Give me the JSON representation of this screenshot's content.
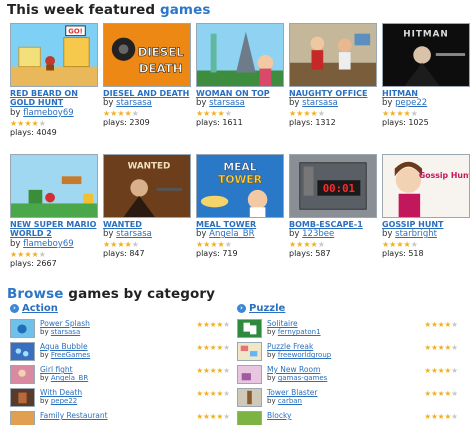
{
  "featured": {
    "title_prefix": "This week featured ",
    "title_accent": "games",
    "by_label": "by ",
    "plays_label": "plays: ",
    "games": [
      {
        "name": "RED BEARD ON GOLD HUNT",
        "author": "flameboy69",
        "plays": "4049",
        "rating": 4
      },
      {
        "name": "DIESEL AND DEATH",
        "author": "starsasa",
        "plays": "2309",
        "rating": 4
      },
      {
        "name": "WOMAN ON TOP",
        "author": "starsasa",
        "plays": "1611",
        "rating": 4
      },
      {
        "name": "NAUGHTY OFFICE",
        "author": "starsasa",
        "plays": "1312",
        "rating": 4
      },
      {
        "name": "HITMAN",
        "author": "pepe22",
        "plays": "1025",
        "rating": 4
      },
      {
        "name": "NEW SUPER MARIO WORLD 2",
        "author": "flameboy69",
        "plays": "2667",
        "rating": 4
      },
      {
        "name": "WANTED",
        "author": "starsasa",
        "plays": "847",
        "rating": 4
      },
      {
        "name": "MEAL TOWER",
        "author": "Angela_BR",
        "plays": "719",
        "rating": 4
      },
      {
        "name": "BOMB-ESCAPE-1",
        "author": "123bee",
        "plays": "587",
        "rating": 4
      },
      {
        "name": "GOSSIP HUNT",
        "author": "starbright",
        "plays": "518",
        "rating": 4
      }
    ],
    "thumb_text": {
      "diesel_line1": "DIESEL",
      "diesel_line2": "DEATH",
      "hitman": "HITMAN",
      "wanted": "WANTED",
      "meal_line1": "MEAL",
      "meal_line2": "TOWER",
      "bomb_timer": "00:01",
      "gossip": "Gossip Hunt",
      "redbeard_sign": "GO!"
    }
  },
  "browse": {
    "title_accent": "Browse",
    "title_rest": " games by category",
    "by_label": "by ",
    "categories": [
      {
        "name": "Action",
        "games": [
          {
            "title": "Power Splash",
            "author": "starsasa",
            "rating": 4
          },
          {
            "title": "Aqua Bubble",
            "author": "FreeGames",
            "rating": 4
          },
          {
            "title": "Girl fight",
            "author": "Angela_BR",
            "rating": 4
          },
          {
            "title": "With Death",
            "author": "pepe22",
            "rating": 4
          },
          {
            "title": "Family Restaurant",
            "author": "",
            "rating": 4
          }
        ]
      },
      {
        "name": "Puzzle",
        "games": [
          {
            "title": "Solitaire",
            "author": "fernypaton1",
            "rating": 4
          },
          {
            "title": "Puzzle Freak",
            "author": "freeworldgroup",
            "rating": 4
          },
          {
            "title": "My New Room",
            "author": "gamas-games",
            "rating": 4
          },
          {
            "title": "Tower Blaster",
            "author": "carban",
            "rating": 4
          },
          {
            "title": "Blocky",
            "author": "",
            "rating": 4
          }
        ]
      }
    ]
  },
  "colors": {
    "accent": "#2b77c8",
    "link": "#2b6fbf",
    "star_on": "#f2b01e",
    "star_off": "#c8c8c8"
  }
}
